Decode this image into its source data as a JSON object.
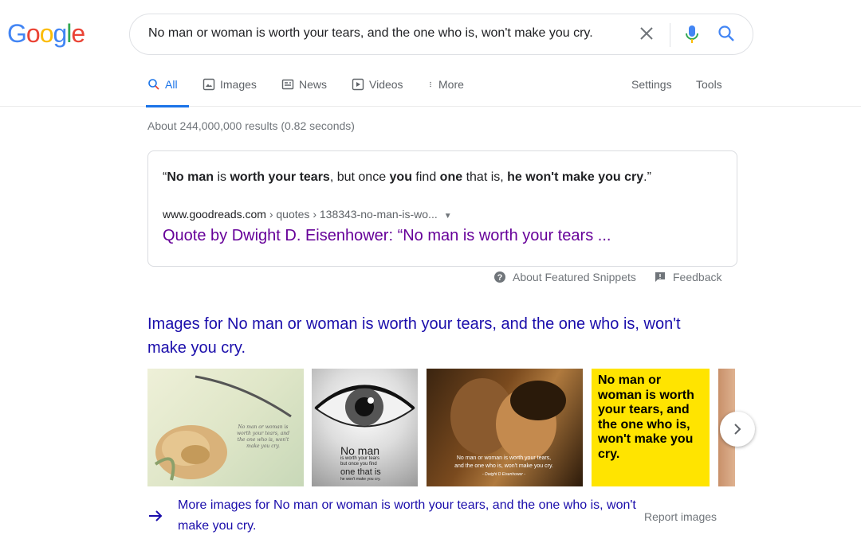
{
  "logo": {
    "letters": [
      "G",
      "o",
      "o",
      "g",
      "l",
      "e"
    ],
    "colors": [
      "#4285f4",
      "#ea4335",
      "#fbbc05",
      "#4285f4",
      "#34a853",
      "#ea4335"
    ]
  },
  "search": {
    "query": "No man or woman is worth your tears, and the one who is, won't make you cry."
  },
  "tabs": [
    {
      "label": "All",
      "icon": "search-icon",
      "active": true
    },
    {
      "label": "Images",
      "icon": "image-icon",
      "active": false
    },
    {
      "label": "News",
      "icon": "news-icon",
      "active": false
    },
    {
      "label": "Videos",
      "icon": "video-icon",
      "active": false
    },
    {
      "label": "More",
      "icon": "more-vert-icon",
      "active": false
    }
  ],
  "tools": {
    "settings": "Settings",
    "tools": "Tools"
  },
  "stats": "About 244,000,000 results (0.82 seconds)",
  "snippet": {
    "quote_parts": [
      {
        "text": "“",
        "bold": false
      },
      {
        "text": "No man",
        "bold": true
      },
      {
        "text": " is ",
        "bold": false
      },
      {
        "text": "worth your tears",
        "bold": true
      },
      {
        "text": ", but once ",
        "bold": false
      },
      {
        "text": "you",
        "bold": true
      },
      {
        "text": " find ",
        "bold": false
      },
      {
        "text": "one",
        "bold": true
      },
      {
        "text": " that is, ",
        "bold": false
      },
      {
        "text": "he won't make you cry",
        "bold": true
      },
      {
        "text": ".”",
        "bold": false
      }
    ],
    "domain": "www.goodreads.com",
    "path": " › quotes › 138343-no-man-is-wo...",
    "title": "Quote by Dwight D. Eisenhower: “No man is worth your tears ..."
  },
  "about_snippets": "About Featured Snippets",
  "feedback": "Feedback",
  "images_heading": "Images for No man or woman is worth your tears, and the one who is, won't make you cry.",
  "thumbnails": [
    {
      "caption": "No man or woman is worth your tears, and the one who is, won't make you cry."
    },
    {
      "caption_lines": [
        "No man",
        "is worth your tears",
        "but once you find",
        "one that is",
        "he won't make you cry."
      ]
    },
    {
      "caption_lines": [
        "No man or woman is worth your tears,",
        "and the one who is, won't make you cry.",
        "- Dwight D Eisenhower -"
      ]
    },
    {
      "caption": "No man or woman is worth your tears, and the one who is, won't make you cry.",
      "bg": "#ffe400"
    },
    {
      "caption": ""
    }
  ],
  "more_images": "More images for No man or woman is worth your tears, and the one who is, won't make you cry.",
  "report_images": "Report images"
}
